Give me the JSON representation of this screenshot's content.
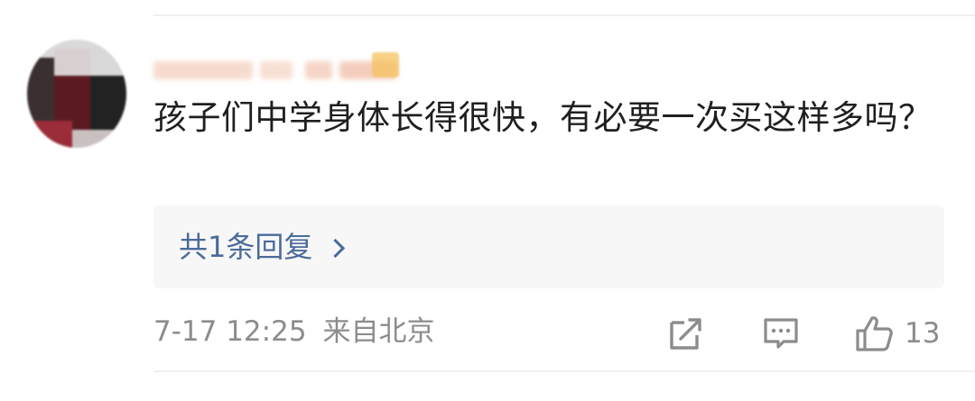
{
  "comment": {
    "text": "孩子们中学身体长得很快，有必要一次买这样多吗？",
    "reply_link": "共1条回复",
    "timestamp": "7-17 12:25",
    "location": "来自北京",
    "like_count": "13"
  },
  "icons": {
    "share": "share-icon",
    "comment": "comment-icon",
    "like": "thumbs-up-icon",
    "chevron": "chevron-right-icon"
  },
  "colors": {
    "link": "#4a6b9a",
    "muted": "#8c8c8c",
    "text": "#1f1f1f",
    "reply_bg": "#f7f7f7"
  }
}
